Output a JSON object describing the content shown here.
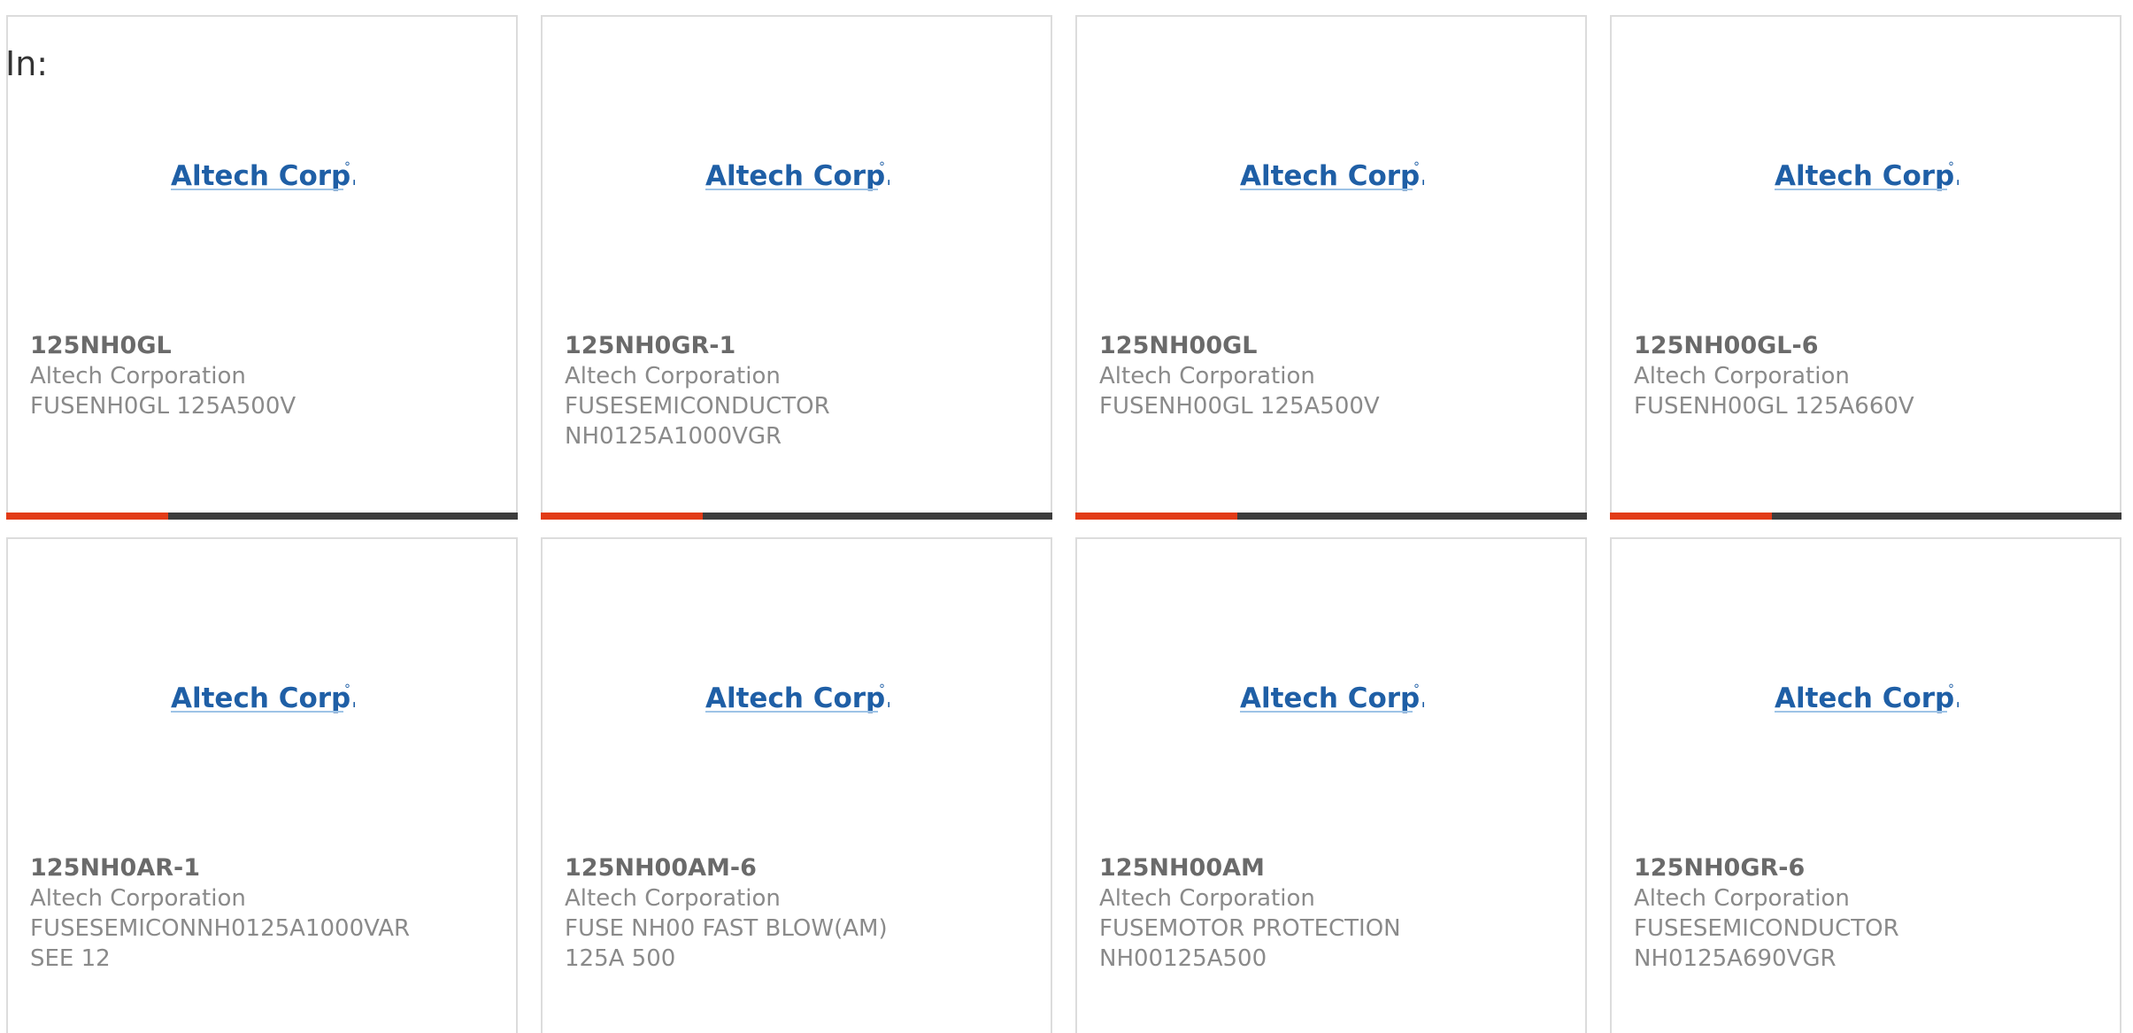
{
  "header": {
    "label": "In:"
  },
  "brand": {
    "logo_text": "Altech Corp.",
    "logo_mark": "°",
    "logo_color": "#1f5fa6",
    "accent_color": "#e23b17"
  },
  "products": [
    {
      "part": "125NH0GL",
      "manufacturer": "Altech Corporation",
      "description": "FUSENH0GL 125A500V"
    },
    {
      "part": "125NH0GR-1",
      "manufacturer": "Altech Corporation",
      "description": "FUSESEMICONDUCTOR NH0125A1000VGR"
    },
    {
      "part": "125NH00GL",
      "manufacturer": "Altech Corporation",
      "description": "FUSENH00GL 125A500V"
    },
    {
      "part": "125NH00GL-6",
      "manufacturer": "Altech Corporation",
      "description": "FUSENH00GL 125A660V"
    },
    {
      "part": "125NH0AR-1",
      "manufacturer": "Altech Corporation",
      "description": "FUSESEMICONNH0125A1000VAR SEE 12"
    },
    {
      "part": "125NH00AM-6",
      "manufacturer": "Altech Corporation",
      "description": "FUSE NH00 FAST BLOW(AM) 125A 500"
    },
    {
      "part": "125NH00AM",
      "manufacturer": "Altech Corporation",
      "description": "FUSEMOTOR PROTECTION NH00125A500"
    },
    {
      "part": "125NH0GR-6",
      "manufacturer": "Altech Corporation",
      "description": "FUSESEMICONDUCTOR NH0125A690VGR"
    }
  ]
}
